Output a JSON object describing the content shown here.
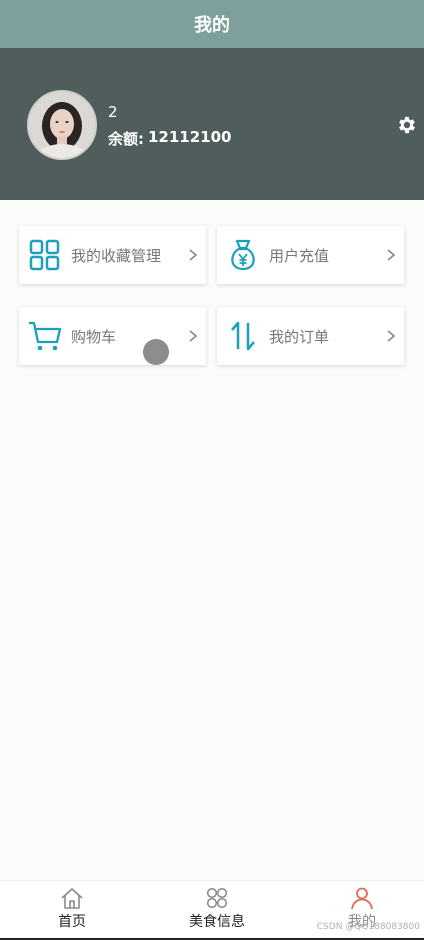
{
  "header": {
    "title": "我的"
  },
  "profile": {
    "username": "2",
    "balance_label": "余额:",
    "balance_value": "12112100"
  },
  "menu": [
    {
      "label": "我的收藏管理",
      "icon": "grid-icon"
    },
    {
      "label": "用户充值",
      "icon": "money-bag-icon"
    },
    {
      "label": "购物车",
      "icon": "cart-icon"
    },
    {
      "label": "我的订单",
      "icon": "sort-arrows-icon"
    }
  ],
  "nav": [
    {
      "label": "首页",
      "icon": "home-icon"
    },
    {
      "label": "美食信息",
      "icon": "four-circles-icon"
    },
    {
      "label": "我的",
      "icon": "user-icon"
    }
  ],
  "watermark": "CSDN @QQ188083800",
  "colors": {
    "header_bg": "#7f9f9c",
    "profile_bg": "#4f5e5d",
    "accent": "#1aa0b8",
    "active_nav": "#e06b5b"
  }
}
